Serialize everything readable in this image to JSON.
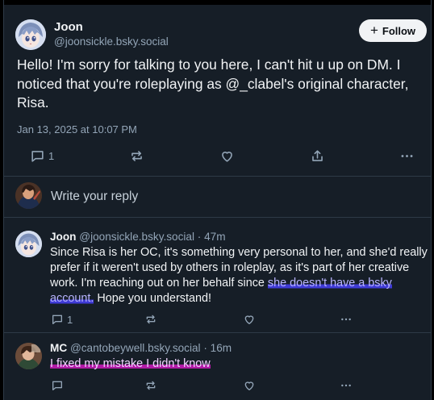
{
  "post": {
    "author_name": "Joon",
    "author_handle": "@joonsickle.bsky.social",
    "follow_label": "Follow",
    "text": "Hello! I'm sorry for talking to you here, I can't hit u up on DM. I noticed that you're roleplaying as @_clabel's original character, Risa.",
    "timestamp": "Jan 13, 2025 at 10:07 PM",
    "reply_count": "1"
  },
  "composer": {
    "placeholder": "Write your reply"
  },
  "replies": [
    {
      "name": "Joon",
      "handle": "@joonsickle.bsky.social",
      "sep": " · ",
      "time": "47m",
      "text_before": "Since Risa is her OC, it's something very personal to her, and she'd really prefer if it weren't used by others in roleplay, as it's part of her creative work. I'm reaching out on her behalf since ",
      "text_highlight": "she doesn't have a bsky account.",
      "text_after": " Hope you understand!",
      "reply_count": "1"
    },
    {
      "name": "MC",
      "handle": "@cantobeywell.bsky.social",
      "sep": " · ",
      "time": "16m",
      "text_highlight": "I fixed my mistake I didn't know"
    }
  ],
  "colors": {
    "background": "#161e27",
    "text": "#f1f3f5",
    "muted": "#93a5b7",
    "highlight_blue": "#3f3ad6",
    "highlight_pink": "#b11aa6"
  },
  "icons": [
    "reply-icon",
    "repost-icon",
    "like-icon",
    "share-icon",
    "more-icon",
    "plus-icon"
  ]
}
